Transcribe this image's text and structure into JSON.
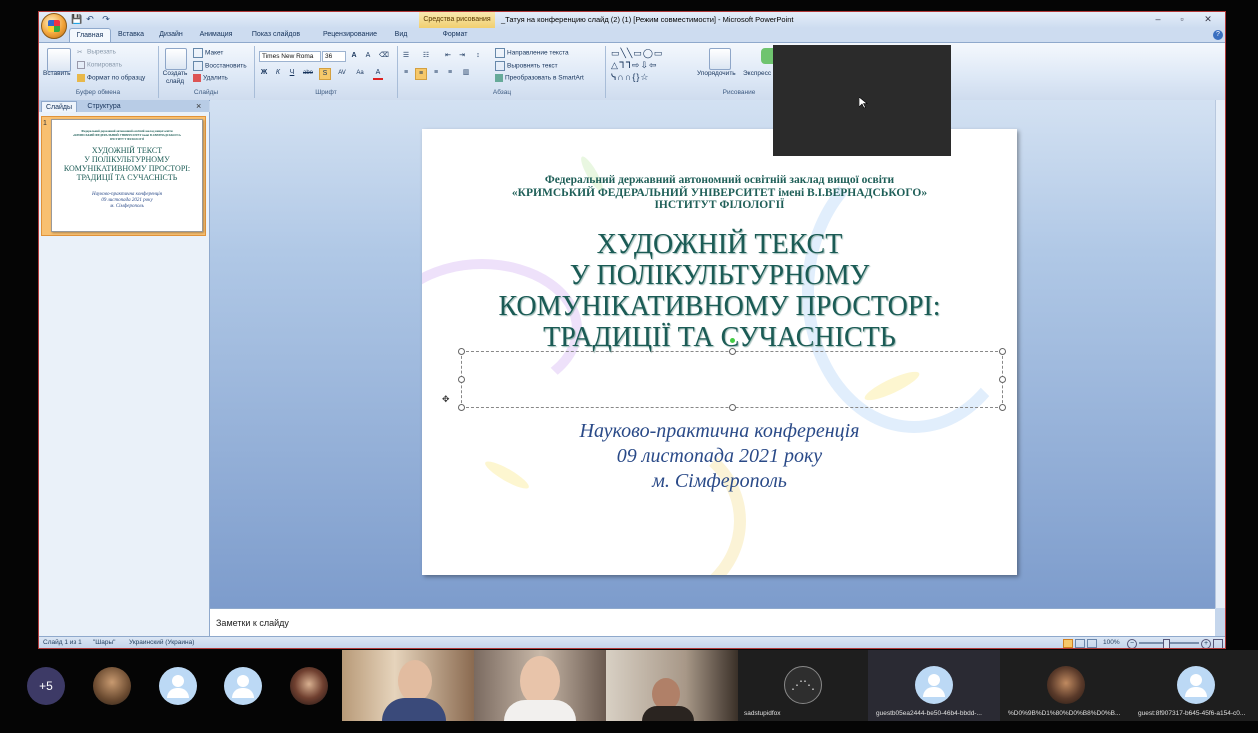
{
  "window": {
    "title": "_Татуя на конференцию слайд (2) (1) [Режим совместимости] - Microsoft PowerPoint",
    "context_tab": "Средства рисования",
    "controls": [
      "–",
      "▫",
      "✕"
    ]
  },
  "quick_access": [
    "💾",
    "↶",
    "↷"
  ],
  "tabs": [
    "Главная",
    "Вставка",
    "Дизайн",
    "Анимация",
    "Показ слайдов",
    "Рецензирование",
    "Вид",
    "Формат"
  ],
  "ribbon": {
    "clipboard": {
      "paste": "Вставить",
      "cut": "Вырезать",
      "copy": "Копировать",
      "format_painter": "Формат по образцу",
      "label": "Буфер обмена"
    },
    "slides": {
      "new_slide": "Создать слайд",
      "layout": "Макет",
      "reset": "Восстановить",
      "delete": "Удалить",
      "label": "Слайды"
    },
    "font": {
      "name": "Times New Roma",
      "size": "36",
      "label": "Шрифт",
      "buttons": [
        "Ж",
        "К",
        "Ч",
        "abe",
        "S",
        "AV",
        "Aa",
        "A"
      ]
    },
    "paragraph": {
      "text_direction": "Направление текста",
      "align_text": "Выровнять текст",
      "smartart": "Преобразовать в SmartArt",
      "label": "Абзац"
    },
    "drawing": {
      "arrange": "Упорядочить",
      "quick_styles": "Экспресс",
      "label": "Рисование"
    }
  },
  "pane": {
    "tabs": [
      "Слайды",
      "Структура"
    ],
    "slide_number": "1",
    "close": "×"
  },
  "slide": {
    "institution": [
      "Федеральний державний автономний освітній заклад вищої освіти",
      "«КРИМСЬКИЙ ФЕДЕРАЛЬНИЙ УНІВЕРСИТЕТ імені В.І.ВЕРНАДСЬКОГО»",
      "ІНСТИТУТ ФІЛОЛОГІЇ"
    ],
    "title": [
      "ХУДОЖНІЙ ТЕКСТ",
      "У ПОЛІКУЛЬТУРНОМУ",
      "КОМУНІКАТИВНОМУ ПРОСТОРІ:",
      "ТРАДИЦІЇ ТА СУЧАСНІСТЬ"
    ],
    "subtitle": [
      "Науково-практична конференція",
      "09 листопада 2021 року",
      "м. Сімферополь"
    ]
  },
  "notes_placeholder": "Заметки к слайду",
  "status": {
    "slide_of": "Слайд 1 из 1",
    "theme": "\"Шары\"",
    "language": "Украинский (Украина)",
    "zoom": "100%"
  },
  "participants": {
    "more_count": "+5",
    "names": [
      "sadstupidfox",
      "guestb05ea2444-be50-46b4-bbdd-...",
      "%D0%9B%D1%80%D0%B8%D0%B...",
      "guest:8f907317-b645-45f6-a154-c0..."
    ]
  }
}
